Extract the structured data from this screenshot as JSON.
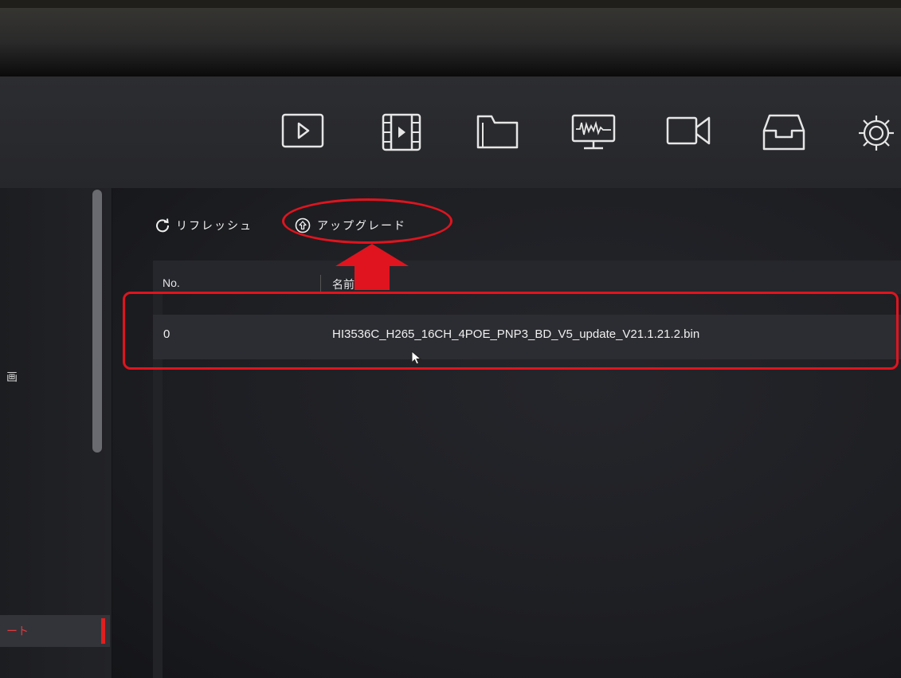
{
  "topnav": {
    "icons": [
      "playback-icon",
      "video-clip-icon",
      "folder-icon",
      "monitor-icon",
      "camera-icon",
      "inbox-icon",
      "gear-icon"
    ]
  },
  "sidebar": {
    "partial_item": "画",
    "active_item": "ート"
  },
  "toolbar": {
    "refresh_label": "リフレッシュ",
    "upgrade_label": "アップグレード"
  },
  "table": {
    "headers": [
      "No.",
      "名前"
    ],
    "rows": [
      {
        "no": "0",
        "name": "HI3536C_H265_16CH_4POE_PNP3_BD_V5_update_V21.1.21.2.bin"
      }
    ]
  },
  "colors": {
    "annotation_red": "#e0141e",
    "active_accent": "#e01f1f"
  }
}
